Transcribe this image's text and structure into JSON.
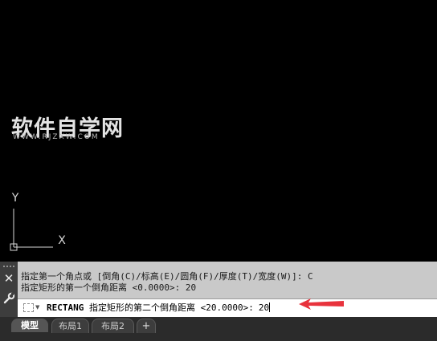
{
  "watermark": {
    "title": "软件自学网",
    "url": "WWW.RJZXW.COM"
  },
  "ucs": {
    "x_axis": "X",
    "y_axis": "Y"
  },
  "command_line": {
    "close_icon": "close-icon",
    "wrench_icon": "wrench-icon",
    "history": [
      "指定第一个角点或 [倒角(C)/标高(E)/圆角(F)/厚度(T)/宽度(W)]: C",
      "指定矩形的第一个倒角距离 <0.0000>: 20"
    ],
    "prompt_command": "RECTANG",
    "prompt_text": "指定矩形的第二个倒角距离 <20.0000>:",
    "input_value": "20",
    "pointer_color": "#e8323c"
  },
  "tabs": [
    {
      "label": "模型",
      "active": true
    },
    {
      "label": "布局1",
      "active": false
    },
    {
      "label": "布局2",
      "active": false
    },
    {
      "label": "+",
      "active": false
    }
  ]
}
